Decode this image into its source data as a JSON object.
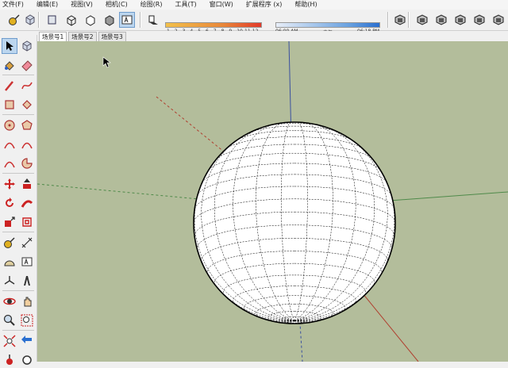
{
  "menu": [
    "文件(F)",
    "编辑(E)",
    "视图(V)",
    "相机(C)",
    "绘图(R)",
    "工具(T)",
    "窗口(W)",
    "扩展程序 (x)",
    "帮助(H)"
  ],
  "toolbar": {
    "buttons": [
      "tape-measure-icon",
      "component-icon",
      "xray-style-icon",
      "wireframe-style-icon",
      "hidden-line-style-icon",
      "shaded-style-icon",
      "shaded-textures-style-icon",
      "monochrome-style-icon",
      "shadows-icon",
      "iso-view-icon",
      "top-view-icon",
      "front-view-icon",
      "right-view-icon",
      "back-view-icon",
      "left-view-icon"
    ],
    "active": "shaded-textures-style-icon",
    "month_ticks": [
      "1",
      "2",
      "3",
      "4",
      "5",
      "6",
      "7",
      "8",
      "9",
      "10",
      "11",
      "12"
    ],
    "time_start": "06:00 AM",
    "time_mid": "中午",
    "time_end": "06:18 PM",
    "shadow_colors": [
      "#f2c04a",
      "#e23a2a"
    ],
    "time_colors": [
      "#6aa2e0",
      "#2a6fd0"
    ]
  },
  "scene_tabs": [
    "场景号1",
    "场景号2",
    "场景号3"
  ],
  "active_scene": 0,
  "left_tools": [
    [
      "select-arrow-icon",
      "make-component-icon"
    ],
    [
      "paint-bucket-icon",
      "eraser-icon"
    ],
    [
      "line-icon",
      "freehand-icon"
    ],
    [
      "rectangle-icon",
      "rotated-rectangle-icon"
    ],
    [
      "circle-icon",
      "polygon-icon"
    ],
    [
      "arc-icon",
      "two-point-arc-icon"
    ],
    [
      "three-point-arc-icon",
      "pie-icon"
    ],
    [
      "move-icon",
      "push-pull-icon"
    ],
    [
      "rotate-icon",
      "follow-me-icon"
    ],
    [
      "scale-icon",
      "offset-icon"
    ],
    [
      "tape-measure-icon",
      "dimension-icon"
    ],
    [
      "protractor-icon",
      "text-icon"
    ],
    [
      "axes-icon",
      "3d-text-icon"
    ],
    [
      "orbit-icon",
      "pan-icon"
    ],
    [
      "zoom-icon",
      "zoom-window-icon"
    ],
    [
      "zoom-extents-icon",
      "previous-view-icon"
    ],
    [
      "position-camera-icon",
      "look-around-icon"
    ]
  ],
  "colors": {
    "viewport_bg": "#b3bd9b",
    "axis_red": "#b04030",
    "axis_green": "#4f8a4a",
    "axis_blue": "#3a50a0",
    "sphere_fill": "#ffffff",
    "sphere_wire": "#000000"
  }
}
